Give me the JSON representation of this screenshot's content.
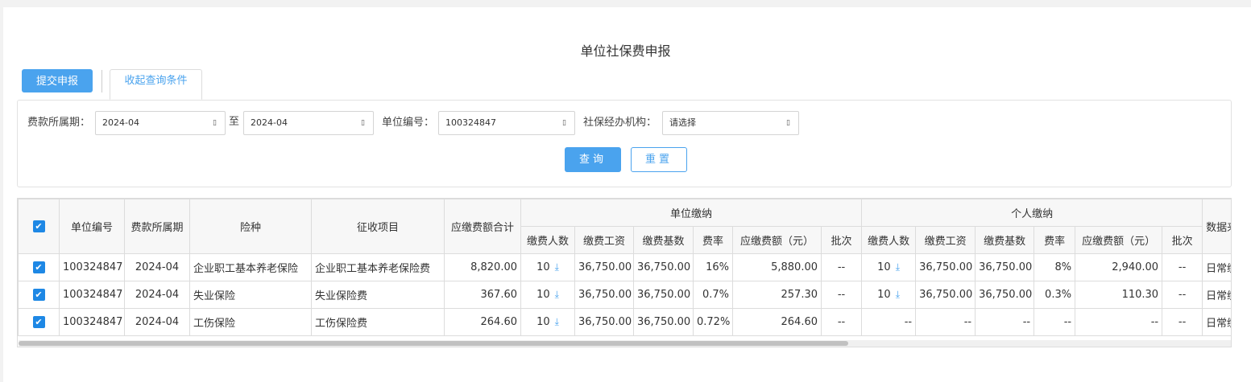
{
  "page": {
    "title": "单位社保费申报"
  },
  "toolbar": {
    "submit_label": "提交申报",
    "collapse_tab_label": "收起查询条件"
  },
  "query": {
    "period_label": "费款所属期：",
    "period_start": "2024-04",
    "period_to": "至",
    "period_end": "2024-04",
    "unit_code_label": "单位编号：",
    "unit_code_value": "100324847",
    "agency_label": "社保经办机构：",
    "agency_placeholder": "请选择",
    "query_button": "查询",
    "reset_button": "重置"
  },
  "table": {
    "headers": {
      "unit_code": "单位编号",
      "period": "费款所属期",
      "insurance_type": "险种",
      "collection_item": "征收项目",
      "total_due": "应缴费额合计",
      "unit_group": "单位缴纳",
      "personal_group": "个人缴纳",
      "data_source": "数据来源"
    },
    "sub_headers": {
      "payer_count": "缴费人数",
      "wage": "缴费工资",
      "base": "缴费基数",
      "rate": "费率",
      "due_amount": "应缴费额（元）",
      "batch": "批次"
    },
    "rows": [
      {
        "unit_code": "100324847",
        "period": "2024-04",
        "insurance_type": "企业职工基本养老保险",
        "collection_item": "企业职工基本养老保险费",
        "total_due": "8,820.00",
        "u_count": "10",
        "u_wage": "36,750.00",
        "u_base": "36,750.00",
        "u_rate": "16%",
        "u_due": "5,880.00",
        "u_batch": "--",
        "p_count": "10",
        "p_wage": "36,750.00",
        "p_base": "36,750.00",
        "p_rate": "8%",
        "p_due": "2,940.00",
        "p_batch": "--",
        "source": "日常缴"
      },
      {
        "unit_code": "100324847",
        "period": "2024-04",
        "insurance_type": "失业保险",
        "collection_item": "失业保险费",
        "total_due": "367.60",
        "u_count": "10",
        "u_wage": "36,750.00",
        "u_base": "36,750.00",
        "u_rate": "0.7%",
        "u_due": "257.30",
        "u_batch": "--",
        "p_count": "10",
        "p_wage": "36,750.00",
        "p_base": "36,750.00",
        "p_rate": "0.3%",
        "p_due": "110.30",
        "p_batch": "--",
        "source": "日常缴"
      },
      {
        "unit_code": "100324847",
        "period": "2024-04",
        "insurance_type": "工伤保险",
        "collection_item": "工伤保险费",
        "total_due": "264.60",
        "u_count": "10",
        "u_wage": "36,750.00",
        "u_base": "36,750.00",
        "u_rate": "0.72%",
        "u_due": "264.60",
        "u_batch": "--",
        "p_count": "--",
        "p_wage": "--",
        "p_base": "--",
        "p_rate": "--",
        "p_due": "--",
        "p_batch": "--",
        "source": "日常缴"
      }
    ]
  },
  "icons": {
    "checkbox": "✔",
    "download": "⤓",
    "calendar": "▯"
  },
  "colors": {
    "accent": "#4aa3ee",
    "checkbox": "#1e88e5"
  }
}
